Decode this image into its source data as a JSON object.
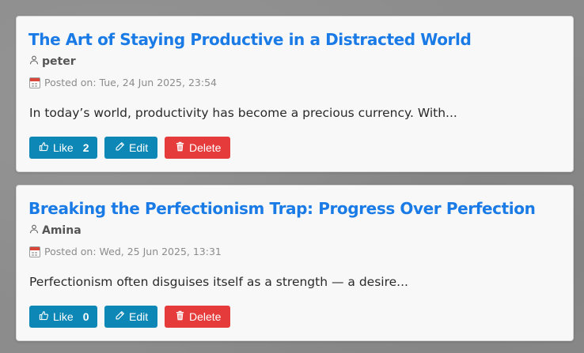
{
  "posts": [
    {
      "title": "The Art of Staying Productive in a Distracted World",
      "author": "peter",
      "date": "Posted on: Tue, 24 Jun 2025, 23:54",
      "excerpt": "In today’s world, productivity has become a precious currency. With...",
      "like_label": "Like",
      "like_count": "2",
      "edit_label": "Edit",
      "delete_label": "Delete"
    },
    {
      "title": "Breaking the Perfectionism Trap: Progress Over Perfection",
      "author": "Amina",
      "date": "Posted on: Wed, 25 Jun 2025, 13:31",
      "excerpt": "Perfectionism often disguises itself as a strength — a desire...",
      "like_label": "Like",
      "like_count": "0",
      "edit_label": "Edit",
      "delete_label": "Delete"
    }
  ],
  "colors": {
    "title": "#1a7be6",
    "primary_button": "#0d87b5",
    "danger_button": "#e53b3b"
  },
  "icons": {
    "author": "user-icon",
    "date": "calendar-icon",
    "like": "thumbs-up-icon",
    "edit": "pencil-icon",
    "delete": "trash-icon"
  }
}
